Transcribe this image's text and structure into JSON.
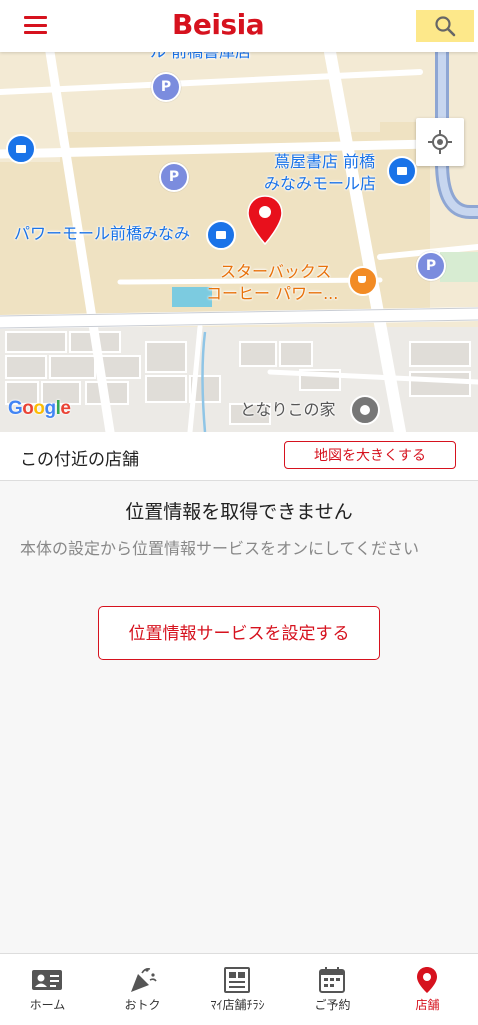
{
  "header": {
    "logo_text": "Beisia",
    "brand_color": "#d6121e",
    "menu_icon": "hamburger-menu-icon",
    "search_icon": "search-icon"
  },
  "map": {
    "labels": {
      "top_partial": "ル 前橋書庫店",
      "tsutaya_line1": "蔦屋書店 前橋",
      "tsutaya_line2": "みなみモール店",
      "powermall": "パワーモール前橋みなみ",
      "starbucks_line1": "スターバックス",
      "starbucks_line2": "コーヒー パワー...",
      "tonari": "となりこの家"
    },
    "parking_label": "P",
    "attribution": "Google"
  },
  "nearby": {
    "title": "この付近の店舗",
    "enlarge_button": "地図を大きくする"
  },
  "message": {
    "title": "位置情報を取得できません",
    "body": "本体の設定から位置情報サービスをオンにしてください",
    "button": "位置情報サービスを設定する"
  },
  "tabs": [
    {
      "label": "ホーム",
      "icon": "id-card-icon",
      "active": false
    },
    {
      "label": "おトク",
      "icon": "party-popper-icon",
      "active": false
    },
    {
      "label": "ﾏｲ店舗ﾁﾗｼ",
      "icon": "flyer-icon",
      "active": false
    },
    {
      "label": "ご予約",
      "icon": "calendar-icon",
      "active": false
    },
    {
      "label": "店舗",
      "icon": "location-pin-icon",
      "active": true
    }
  ]
}
